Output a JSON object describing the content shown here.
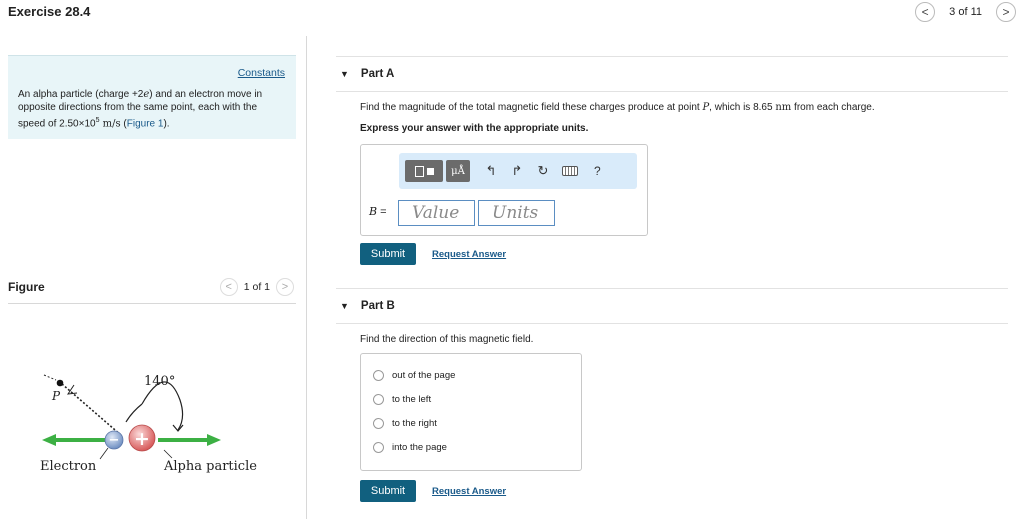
{
  "header": {
    "title": "Exercise 28.4",
    "prev_icon": "<",
    "next_icon": ">",
    "page_text": "3 of 11"
  },
  "problem": {
    "constants_link": "Constants",
    "text_1": "An alpha particle (charge +2",
    "text_e": "e",
    "text_2": ") and an electron move in opposite directions from the same point, each with the speed of 2.50×10",
    "exponent": "5",
    "text_units": " m/s",
    "text_3": " (",
    "figure_link": "Figure 1",
    "text_4": ")."
  },
  "figure": {
    "label": "Figure",
    "page_text": "1 of 1",
    "prev_icon": "<",
    "next_icon": ">",
    "angle_label": "140°",
    "point_label": "P",
    "electron_label": "Electron",
    "alpha_label": "Alpha particle",
    "electron_sign": "−",
    "alpha_sign": "+"
  },
  "partA": {
    "title": "Part A",
    "question_1": "Find the magnitude of the total magnetic field these charges produce at point ",
    "question_P": "P",
    "question_2": ", which is 8.65 ",
    "question_unit": "nm",
    "question_3": " from each charge.",
    "instruction": "Express your answer with the appropriate units.",
    "toolbar": {
      "mu_label": "μÅ",
      "undo_icon": "↰",
      "redo_icon": "↱",
      "reset_icon": "↻",
      "help_label": "?"
    },
    "var_label": "B",
    "equals": " =",
    "value_placeholder": "Value",
    "units_placeholder": "Units",
    "submit_label": "Submit",
    "request_label": "Request Answer"
  },
  "partB": {
    "title": "Part B",
    "question": "Find the direction of this magnetic field.",
    "options": [
      "out of the page",
      "to the left",
      "to the right",
      "into the page"
    ],
    "submit_label": "Submit",
    "request_label": "Request Answer"
  },
  "colors": {
    "accent": "#11607f",
    "link": "#1a5a8a",
    "constants_bg": "#e8f5f8",
    "toolbar_bg": "#d9ebfa",
    "arrow_green": "#3cb044",
    "electron_blue": "#7f9fce",
    "alpha_red": "#e07070"
  }
}
